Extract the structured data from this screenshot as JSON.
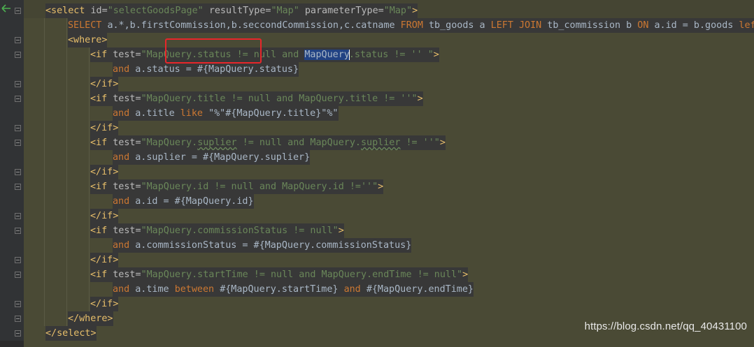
{
  "lines": [
    {
      "id": "select-open",
      "indent": 0,
      "parts": [
        {
          "cls": "tag",
          "t": "<select "
        },
        {
          "cls": "attr",
          "t": "id="
        },
        {
          "cls": "str",
          "t": "\"selectGoodsPage\" "
        },
        {
          "cls": "attr",
          "t": "resultType="
        },
        {
          "cls": "str",
          "t": "\"Map\" "
        },
        {
          "cls": "attr",
          "t": "parameterType="
        },
        {
          "cls": "str",
          "t": "\"Map\""
        },
        {
          "cls": "tag",
          "t": ">"
        }
      ]
    },
    {
      "id": "sql-select",
      "indent": 1,
      "parts": [
        {
          "cls": "kw",
          "t": "SELECT "
        },
        {
          "cls": "txt",
          "t": "a.*,b.firstCommission,b.seccondCommission,c.catname "
        },
        {
          "cls": "kw",
          "t": "FROM "
        },
        {
          "cls": "txt",
          "t": "tb_goods a "
        },
        {
          "cls": "kw",
          "t": "LEFT JOIN "
        },
        {
          "cls": "txt",
          "t": "tb_commission b "
        },
        {
          "cls": "kw",
          "t": "ON "
        },
        {
          "cls": "txt",
          "t": "a.id = b.goods "
        },
        {
          "cls": "kw",
          "t": "left"
        }
      ]
    },
    {
      "id": "where-open",
      "indent": 1,
      "parts": [
        {
          "cls": "tag",
          "t": "<where>"
        }
      ]
    },
    {
      "id": "if-status",
      "indent": 2,
      "parts": [
        {
          "cls": "tag",
          "t": "<if "
        },
        {
          "cls": "attr",
          "t": "test="
        },
        {
          "cls": "str",
          "t": "\"MapQuery.status != null and "
        },
        {
          "cls": "sel",
          "t": "MapQuery"
        },
        {
          "cls": "caret",
          "t": ""
        },
        {
          "cls": "str",
          "t": ".status != '' "
        },
        {
          "cls": "str",
          "t": "\""
        },
        {
          "cls": "tag",
          "t": ">"
        }
      ]
    },
    {
      "id": "and-status",
      "indent": 3,
      "parts": [
        {
          "cls": "kw",
          "t": "and "
        },
        {
          "cls": "txt",
          "t": "a.status = #{MapQuery.status}"
        }
      ]
    },
    {
      "id": "if-close-1",
      "indent": 2,
      "parts": [
        {
          "cls": "tag",
          "t": "</if>"
        }
      ]
    },
    {
      "id": "if-title",
      "indent": 2,
      "parts": [
        {
          "cls": "tag",
          "t": "<if "
        },
        {
          "cls": "attr",
          "t": "test="
        },
        {
          "cls": "str",
          "t": "\"MapQuery.title != null and MapQuery.title != ''\""
        },
        {
          "cls": "tag",
          "t": ">"
        }
      ]
    },
    {
      "id": "and-title",
      "indent": 3,
      "parts": [
        {
          "cls": "kw",
          "t": "and "
        },
        {
          "cls": "txt",
          "t": "a.title "
        },
        {
          "cls": "kw",
          "t": "like "
        },
        {
          "cls": "txt",
          "t": "\"%\"#{MapQuery.title}\"%\""
        }
      ]
    },
    {
      "id": "if-close-2",
      "indent": 2,
      "parts": [
        {
          "cls": "tag",
          "t": "</if>"
        }
      ]
    },
    {
      "id": "if-suplier",
      "indent": 2,
      "parts": [
        {
          "cls": "tag",
          "t": "<if "
        },
        {
          "cls": "attr",
          "t": "test="
        },
        {
          "cls": "str",
          "t": "\"MapQuery."
        },
        {
          "cls": "str squig",
          "t": "suplier"
        },
        {
          "cls": "str",
          "t": " != null and MapQuery."
        },
        {
          "cls": "str squig",
          "t": "suplier"
        },
        {
          "cls": "str",
          "t": " != ''\""
        },
        {
          "cls": "tag",
          "t": ">"
        }
      ]
    },
    {
      "id": "and-suplier",
      "indent": 3,
      "parts": [
        {
          "cls": "kw",
          "t": "and "
        },
        {
          "cls": "txt",
          "t": "a.suplier = #{MapQuery.suplier}"
        }
      ]
    },
    {
      "id": "if-close-3",
      "indent": 2,
      "parts": [
        {
          "cls": "tag",
          "t": "</if>"
        }
      ]
    },
    {
      "id": "if-id",
      "indent": 2,
      "parts": [
        {
          "cls": "tag",
          "t": "<if "
        },
        {
          "cls": "attr",
          "t": "test="
        },
        {
          "cls": "str",
          "t": "\"MapQuery.id != null and MapQuery.id !=''\""
        },
        {
          "cls": "tag",
          "t": ">"
        }
      ]
    },
    {
      "id": "and-id",
      "indent": 3,
      "parts": [
        {
          "cls": "kw",
          "t": "and "
        },
        {
          "cls": "txt",
          "t": "a.id = #{MapQuery.id}"
        }
      ]
    },
    {
      "id": "if-close-4",
      "indent": 2,
      "parts": [
        {
          "cls": "tag",
          "t": "</if>"
        }
      ]
    },
    {
      "id": "if-commission",
      "indent": 2,
      "parts": [
        {
          "cls": "tag",
          "t": "<if "
        },
        {
          "cls": "attr",
          "t": "test="
        },
        {
          "cls": "str",
          "t": "\"MapQuery.commissionStatus != null\""
        },
        {
          "cls": "tag",
          "t": ">"
        }
      ]
    },
    {
      "id": "and-commission",
      "indent": 3,
      "parts": [
        {
          "cls": "kw",
          "t": "and "
        },
        {
          "cls": "txt",
          "t": "a.commissionStatus = #{MapQuery.commissionStatus}"
        }
      ]
    },
    {
      "id": "if-close-5",
      "indent": 2,
      "parts": [
        {
          "cls": "tag",
          "t": "</if>"
        }
      ]
    },
    {
      "id": "if-time",
      "indent": 2,
      "parts": [
        {
          "cls": "tag",
          "t": "<if "
        },
        {
          "cls": "attr",
          "t": "test="
        },
        {
          "cls": "str",
          "t": "\"MapQuery.startTime != null and MapQuery.endTime != null\""
        },
        {
          "cls": "tag",
          "t": ">"
        }
      ]
    },
    {
      "id": "and-time",
      "indent": 3,
      "parts": [
        {
          "cls": "kw",
          "t": "and "
        },
        {
          "cls": "txt",
          "t": "a.time "
        },
        {
          "cls": "kw",
          "t": "between "
        },
        {
          "cls": "txt",
          "t": "#{MapQuery.startTime} "
        },
        {
          "cls": "kw",
          "t": "and "
        },
        {
          "cls": "txt",
          "t": "#{MapQuery.endTime}"
        }
      ]
    },
    {
      "id": "if-close-6",
      "indent": 2,
      "parts": [
        {
          "cls": "tag",
          "t": "</if>"
        }
      ]
    },
    {
      "id": "where-close",
      "indent": 1,
      "parts": [
        {
          "cls": "tag",
          "t": "</where>"
        }
      ]
    },
    {
      "id": "select-close",
      "indent": 0,
      "parts": [
        {
          "cls": "tag",
          "t": "</select>"
        }
      ]
    }
  ],
  "watermark": "https://blog.csdn.net/qq_40431100",
  "colors": {
    "background": "#2b2b2b",
    "gutter": "#313335",
    "highlight_band": "#4a4a35",
    "keyword": "#cc7832",
    "tag": "#e8bf6a",
    "string": "#6a8759",
    "text": "#a9b7c6",
    "selection": "#214283",
    "annotation_box": "#e8262a"
  }
}
